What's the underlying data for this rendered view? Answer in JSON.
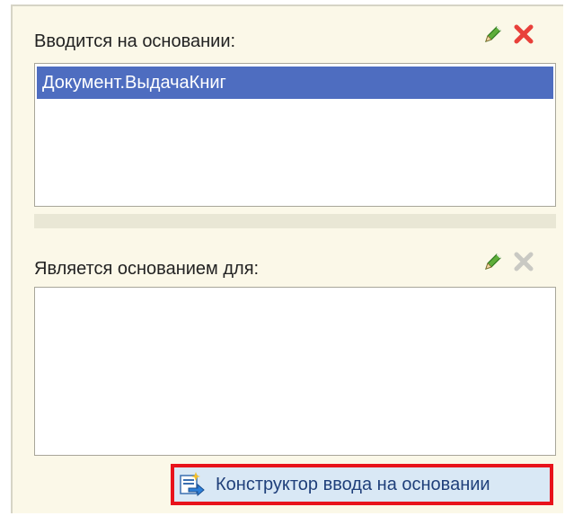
{
  "based_on": {
    "label": "Вводится на основании:",
    "items": [
      "Документ.ВыдачаКниг"
    ],
    "edit_icon": "pencil-icon",
    "delete_icon": "close-icon"
  },
  "basis_for": {
    "label": "Является основанием для:",
    "items": [],
    "edit_icon": "pencil-icon",
    "delete_icon": "close-icon-disabled"
  },
  "constructor_button": {
    "label": "Конструктор ввода на основании",
    "icon": "wizard-icon"
  },
  "colors": {
    "selection": "#4e6dc0",
    "delete_active": "#e8403a",
    "delete_disabled": "#c9c9c3",
    "highlight_border": "#e8131b"
  }
}
